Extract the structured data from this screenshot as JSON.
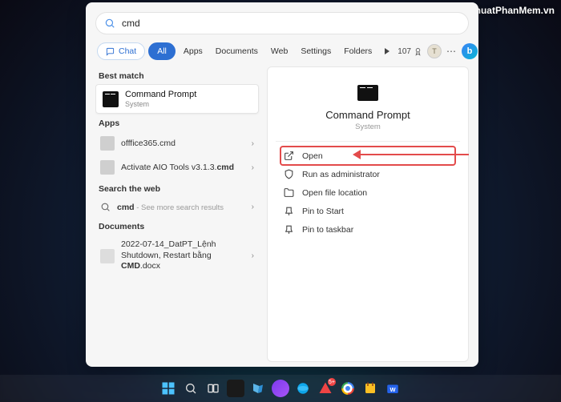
{
  "watermark": "ThuThuatPhanMem.vn",
  "search": {
    "query": "cmd"
  },
  "tabs": {
    "chat": "Chat",
    "all": "All",
    "apps": "Apps",
    "documents": "Documents",
    "web": "Web",
    "settings": "Settings",
    "folders": "Folders",
    "rewards": "107"
  },
  "user_initial": "T",
  "sections": {
    "best_match": "Best match",
    "apps": "Apps",
    "search_web": "Search the web",
    "documents": "Documents"
  },
  "best_match": {
    "title": "Command Prompt",
    "subtitle": "System"
  },
  "apps_list": [
    {
      "label": "offfice365.cmd"
    },
    {
      "label": "Activate AIO Tools v3.1.3.cmd"
    }
  ],
  "web_search": {
    "term": "cmd",
    "hint": " - See more search results"
  },
  "documents_list": [
    {
      "label": "2022-07-14_DatPT_Lệnh Shutdown, Restart bằng CMD.docx"
    }
  ],
  "preview": {
    "title": "Command Prompt",
    "subtitle": "System"
  },
  "actions": {
    "open": "Open",
    "run_admin": "Run as administrator",
    "open_location": "Open file location",
    "pin_start": "Pin to Start",
    "pin_taskbar": "Pin to taskbar"
  }
}
